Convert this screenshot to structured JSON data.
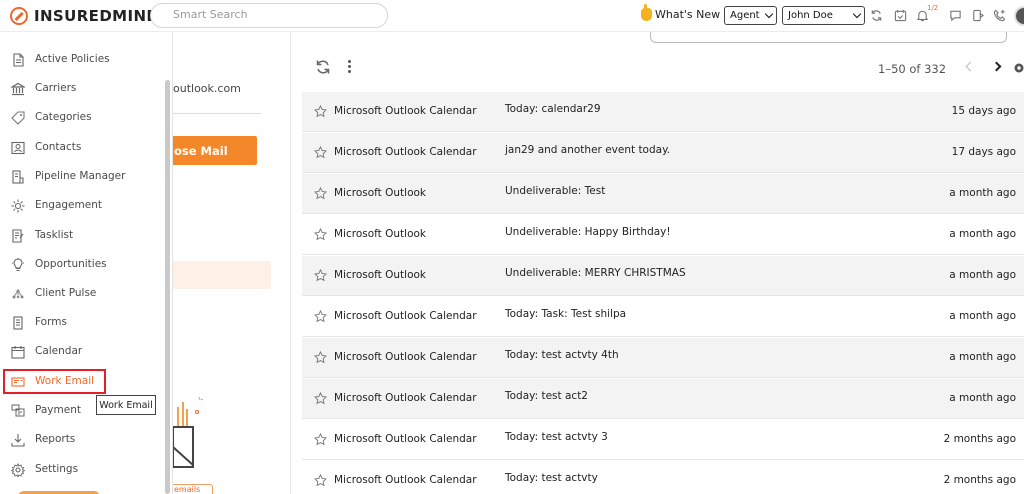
{
  "brand": {
    "name": "INSUREDMINE",
    "accent": "#f0682b"
  },
  "topbar": {
    "search_placeholder": "Smart Search",
    "whats_new": "What's New",
    "role_select": "Agent",
    "user_select": "John Doe",
    "notification_badge": "1/2"
  },
  "sidebar": {
    "items": [
      {
        "label": "Active Policies",
        "icon": "document-icon"
      },
      {
        "label": "Carriers",
        "icon": "bank-icon"
      },
      {
        "label": "Categories",
        "icon": "tag-icon"
      },
      {
        "label": "Contacts",
        "icon": "contact-card-icon"
      },
      {
        "label": "Pipeline Manager",
        "icon": "pipeline-icon"
      },
      {
        "label": "Engagement",
        "icon": "engagement-icon"
      },
      {
        "label": "Tasklist",
        "icon": "tasklist-icon"
      },
      {
        "label": "Opportunities",
        "icon": "lightbulb-icon"
      },
      {
        "label": "Client Pulse",
        "icon": "network-icon"
      },
      {
        "label": "Forms",
        "icon": "form-icon"
      },
      {
        "label": "Calendar",
        "icon": "calendar-icon"
      },
      {
        "label": "Work Email",
        "icon": "email-icon",
        "active": true
      },
      {
        "label": "Payment",
        "icon": "payment-icon"
      },
      {
        "label": "Reports",
        "icon": "download-icon"
      },
      {
        "label": "Settings",
        "icon": "gear-icon"
      }
    ],
    "tooltip": "Work Email"
  },
  "left_panel": {
    "email_fragment": "outlook.com",
    "compose_label": "ose Mail",
    "chip_fragment": "emails"
  },
  "mail": {
    "pagination": "1–50 of 332",
    "rows": [
      {
        "from": "Microsoft Outlook Calendar",
        "subject": "Today: calendar29",
        "time": "15 days ago"
      },
      {
        "from": "Microsoft Outlook Calendar",
        "subject": "jan29 and another event today.",
        "time": "17 days ago"
      },
      {
        "from": "Microsoft Outlook",
        "subject": "Undeliverable: Test",
        "time": "a month ago"
      },
      {
        "from": "Microsoft Outlook",
        "subject": "Undeliverable: Happy Birthday!",
        "time": "a month ago"
      },
      {
        "from": "Microsoft Outlook",
        "subject": "Undeliverable: MERRY CHRISTMAS",
        "time": "a month ago"
      },
      {
        "from": "Microsoft Outlook Calendar",
        "subject": "Today: Task: Test shilpa",
        "time": "a month ago"
      },
      {
        "from": "Microsoft Outlook Calendar",
        "subject": "Today: test actvty 4th",
        "time": "a month ago"
      },
      {
        "from": "Microsoft Outlook Calendar",
        "subject": "Today: test act2",
        "time": "a month ago"
      },
      {
        "from": "Microsoft Outlook Calendar",
        "subject": "Today: test actvty 3",
        "time": "2 months ago"
      },
      {
        "from": "Microsoft Outlook Calendar",
        "subject": "Today: test actvty",
        "time": "2 months ago"
      }
    ]
  }
}
